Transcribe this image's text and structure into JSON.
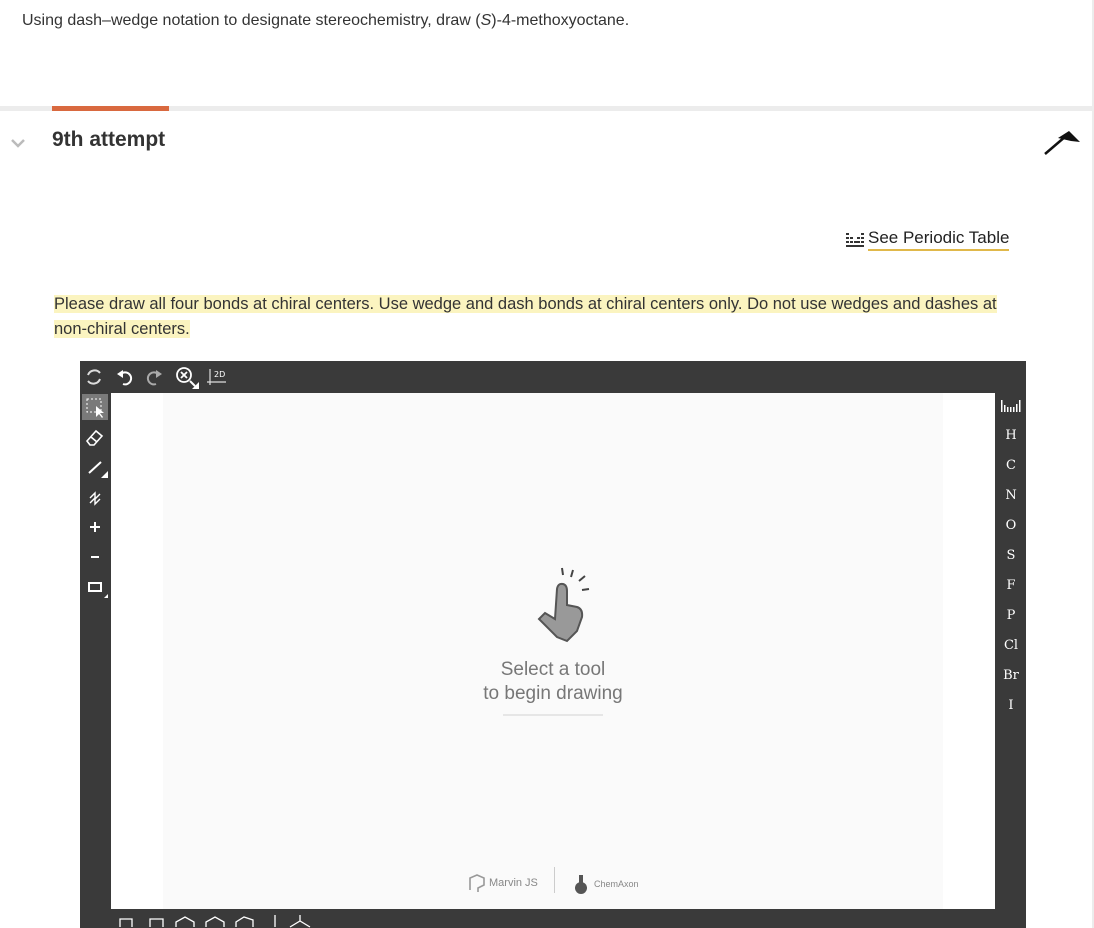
{
  "question": {
    "pre": "Using dash–wedge notation to designate stereochemistry, draw (",
    "italic": "S",
    "post": ")-4-methoxyoctane."
  },
  "attempt": {
    "title": "9th attempt"
  },
  "periodic_table": {
    "label": "See Periodic Table"
  },
  "instruction": "Please draw all four bonds at chiral centers. Use wedge and dash bonds at chiral centers only. Do not use wedges and dashes at non-chiral centers.",
  "editor": {
    "top_tools": [
      "clear-icon",
      "undo-icon",
      "redo-icon",
      "zoom-icon",
      "clean-2d-icon"
    ],
    "clean2d_label": "2D",
    "left_tools": [
      "select-icon",
      "erase-icon",
      "bond-icon",
      "chain-icon",
      "plus-charge-icon",
      "minus-charge-icon",
      "rectangle-icon"
    ],
    "elements": [
      "H",
      "C",
      "N",
      "O",
      "S",
      "F",
      "P",
      "Cl",
      "Br",
      "I"
    ],
    "hint": {
      "line1": "Select a tool",
      "line2": "to begin drawing"
    },
    "brand_left": "Marvin JS",
    "brand_right": "ChemAxon"
  },
  "colors": {
    "accent": "#d9693f",
    "highlight": "#fbf4c0",
    "editor_bg": "#3a3a3a",
    "underline": "#e0b84a"
  }
}
